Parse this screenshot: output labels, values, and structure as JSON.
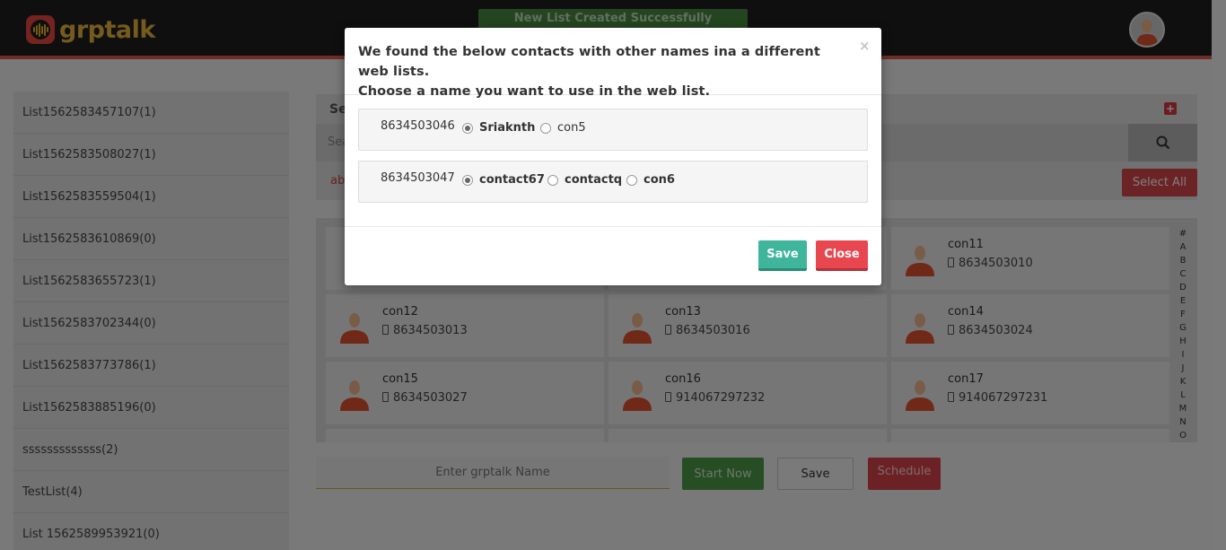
{
  "app": {
    "logo_text": "grptalk"
  },
  "toast": {
    "text": "New List Created Successfully"
  },
  "sidebar": {
    "items": [
      {
        "label": "List1562583457107(1)"
      },
      {
        "label": "List1562583508027(1)"
      },
      {
        "label": "List1562583559504(1)"
      },
      {
        "label": "List1562583610869(0)"
      },
      {
        "label": "List1562583655723(1)"
      },
      {
        "label": "List1562583702344(0)"
      },
      {
        "label": "List1562583773786(1)"
      },
      {
        "label": "List1562583885196(0)"
      },
      {
        "label": "sssssssssssss(2)"
      },
      {
        "label": "TestList(4)"
      },
      {
        "label": "List 1562589953921(0)"
      }
    ]
  },
  "panel": {
    "header_fragment": "Se",
    "search_fragment": "Sea",
    "filter_fragment": "ab",
    "select_all_label": "Select All"
  },
  "contacts": [
    {
      "name": "con11",
      "phone": "8634503010"
    },
    {
      "name": "con12",
      "phone": "8634503013"
    },
    {
      "name": "con13",
      "phone": "8634503016"
    },
    {
      "name": "con14",
      "phone": "8634503024"
    },
    {
      "name": "con15",
      "phone": "8634503027"
    },
    {
      "name": "con16",
      "phone": "914067297232"
    },
    {
      "name": "con17",
      "phone": "914067297231"
    }
  ],
  "alphabet": [
    "#",
    "A",
    "B",
    "C",
    "D",
    "E",
    "F",
    "G",
    "H",
    "I",
    "J",
    "K",
    "L",
    "M",
    "N",
    "O"
  ],
  "bottom_bar": {
    "name_placeholder": "Enter grptalk Name",
    "start_label": "Start Now",
    "save_label": "Save",
    "schedule_label": "Schedule"
  },
  "modal": {
    "title_line1": "We found the below contacts with other names ina a different web lists.",
    "title_line2": "Choose a name you want to use in the web list.",
    "close_glyph": "×",
    "rows": [
      {
        "number": "8634503046",
        "options": [
          {
            "label": "Sriaknth",
            "selected": true
          },
          {
            "label": "con5",
            "selected": false
          }
        ]
      },
      {
        "number": "8634503047",
        "options": [
          {
            "label": "contact67",
            "selected": true
          },
          {
            "label": "contactq",
            "selected": false
          },
          {
            "label": "con6",
            "selected": false
          }
        ]
      }
    ],
    "save_label": "Save",
    "close_label": "Close"
  },
  "colors": {
    "header_bg": "#1e1e1e",
    "accent_red": "#e8474f",
    "save_green": "#3fb59c",
    "logo_gold": "#e8b73a"
  }
}
